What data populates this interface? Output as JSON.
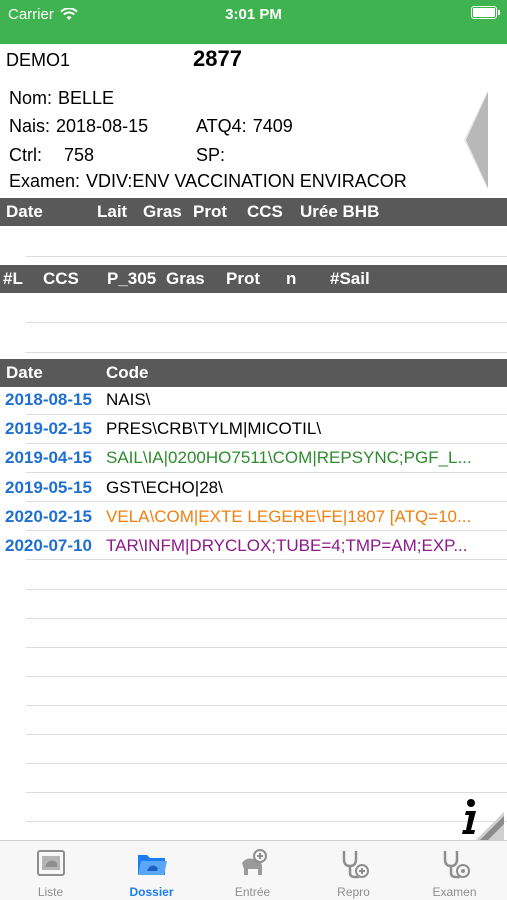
{
  "status": {
    "carrier": "Carrier",
    "time": "3:01 PM"
  },
  "header": {
    "herd": "DEMO1",
    "animal_number": "2877",
    "nom_label": "Nom:",
    "nom_value": "BELLE",
    "nais_label": "Nais:",
    "nais_value": "2018-08-15",
    "atq_label": "ATQ4:",
    "atq_value": "7409",
    "ctrl_label": "Ctrl:",
    "ctrl_value": "758",
    "sp_label": "SP:",
    "sp_value": "",
    "examen_label": "Examen:",
    "examen_value": "VDIV:ENV VACCINATION ENVIRACOR"
  },
  "test_table": {
    "columns": [
      "Date",
      "Lait",
      "Gras",
      "Prot",
      "CCS",
      "Urée BHB"
    ]
  },
  "lact_table": {
    "columns": [
      "#L",
      "CCS",
      "P_305",
      "Gras",
      "Prot",
      "n",
      "#Sail"
    ]
  },
  "events_table": {
    "columns": [
      "Date",
      "Code"
    ],
    "rows": [
      {
        "date": "2018-08-15",
        "code": "NAIS\\",
        "color": "#000000"
      },
      {
        "date": "2019-02-15",
        "code": "PRES\\CRB\\TYLM|MICOTIL\\",
        "color": "#000000"
      },
      {
        "date": "2019-04-15",
        "code": "SAIL\\IA|0200HO7511\\COM|REPSYNC;PGF_L...",
        "color": "#2e8b2e"
      },
      {
        "date": "2019-05-15",
        "code": "GST\\ECHO|28\\",
        "color": "#000000"
      },
      {
        "date": "2020-02-15",
        "code": "VELA\\COM|EXTE LEGERE\\FE|1807 [ATQ=10...",
        "color": "#f07f10"
      },
      {
        "date": "2020-07-10",
        "code": "TAR\\INFM|DRYCLOX;TUBE=4;TMP=AM;EXP...",
        "color": "#8b1a8b"
      }
    ]
  },
  "tabs": [
    {
      "label": "Liste",
      "icon": "list-icon",
      "active": false
    },
    {
      "label": "Dossier",
      "icon": "folder-icon",
      "active": true
    },
    {
      "label": "Entrée",
      "icon": "cow-add-icon",
      "active": false
    },
    {
      "label": "Repro",
      "icon": "stethoscope-add-icon",
      "active": false
    },
    {
      "label": "Examen",
      "icon": "stethoscope-icon",
      "active": false
    }
  ],
  "colors": {
    "status_bar": "#3fb34f",
    "header_bar": "#595959",
    "date_blue": "#1f6fd1",
    "tab_active": "#1b7ef0",
    "tab_inactive": "#8e8e8e"
  }
}
